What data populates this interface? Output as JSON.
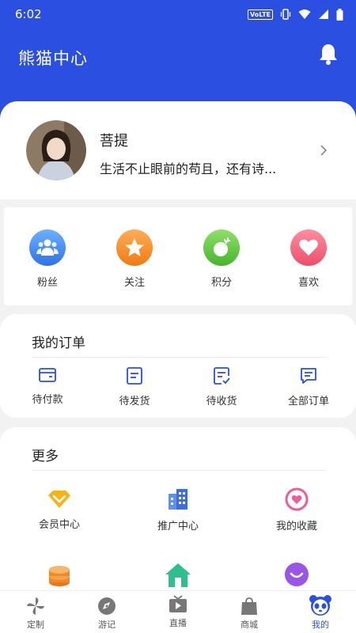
{
  "status_bar": {
    "time": "6:02",
    "volte": "VoLTE"
  },
  "header": {
    "title": "熊猫中心"
  },
  "profile": {
    "name": "菩提",
    "bio": "生活不止眼前的苟且，还有诗..."
  },
  "stats": [
    {
      "label": "粉丝",
      "icon": "fans-icon",
      "color": "#3d8ef0"
    },
    {
      "label": "关注",
      "icon": "star-icon",
      "color": "#f08a24"
    },
    {
      "label": "积分",
      "icon": "points-icon",
      "color": "#5cc83c"
    },
    {
      "label": "喜欢",
      "icon": "heart-icon",
      "color": "#f2647c"
    }
  ],
  "orders": {
    "title": "我的订单",
    "items": [
      {
        "label": "待付款",
        "icon": "wallet-icon"
      },
      {
        "label": "待发货",
        "icon": "ship-doc-icon"
      },
      {
        "label": "待收货",
        "icon": "receive-doc-icon"
      },
      {
        "label": "全部订单",
        "icon": "message-doc-icon"
      }
    ]
  },
  "more": {
    "title": "更多",
    "items": [
      {
        "label": "会员中心",
        "icon": "diamond-icon"
      },
      {
        "label": "推广中心",
        "icon": "building-icon"
      },
      {
        "label": "我的收藏",
        "icon": "favorite-heart-icon"
      },
      {
        "label": "",
        "icon": "coins-icon"
      },
      {
        "label": "",
        "icon": "home-icon"
      },
      {
        "label": "",
        "icon": "smile-icon"
      }
    ]
  },
  "tabs": [
    {
      "label": "定制",
      "icon": "pinwheel-icon"
    },
    {
      "label": "游记",
      "icon": "compass-icon"
    },
    {
      "label": "直播",
      "icon": "tv-icon"
    },
    {
      "label": "商城",
      "icon": "shop-bag-icon"
    },
    {
      "label": "我的",
      "icon": "panda-icon",
      "active": true
    }
  ],
  "colors": {
    "primary": "#2b4fe0",
    "background": "#f2f2f2"
  }
}
